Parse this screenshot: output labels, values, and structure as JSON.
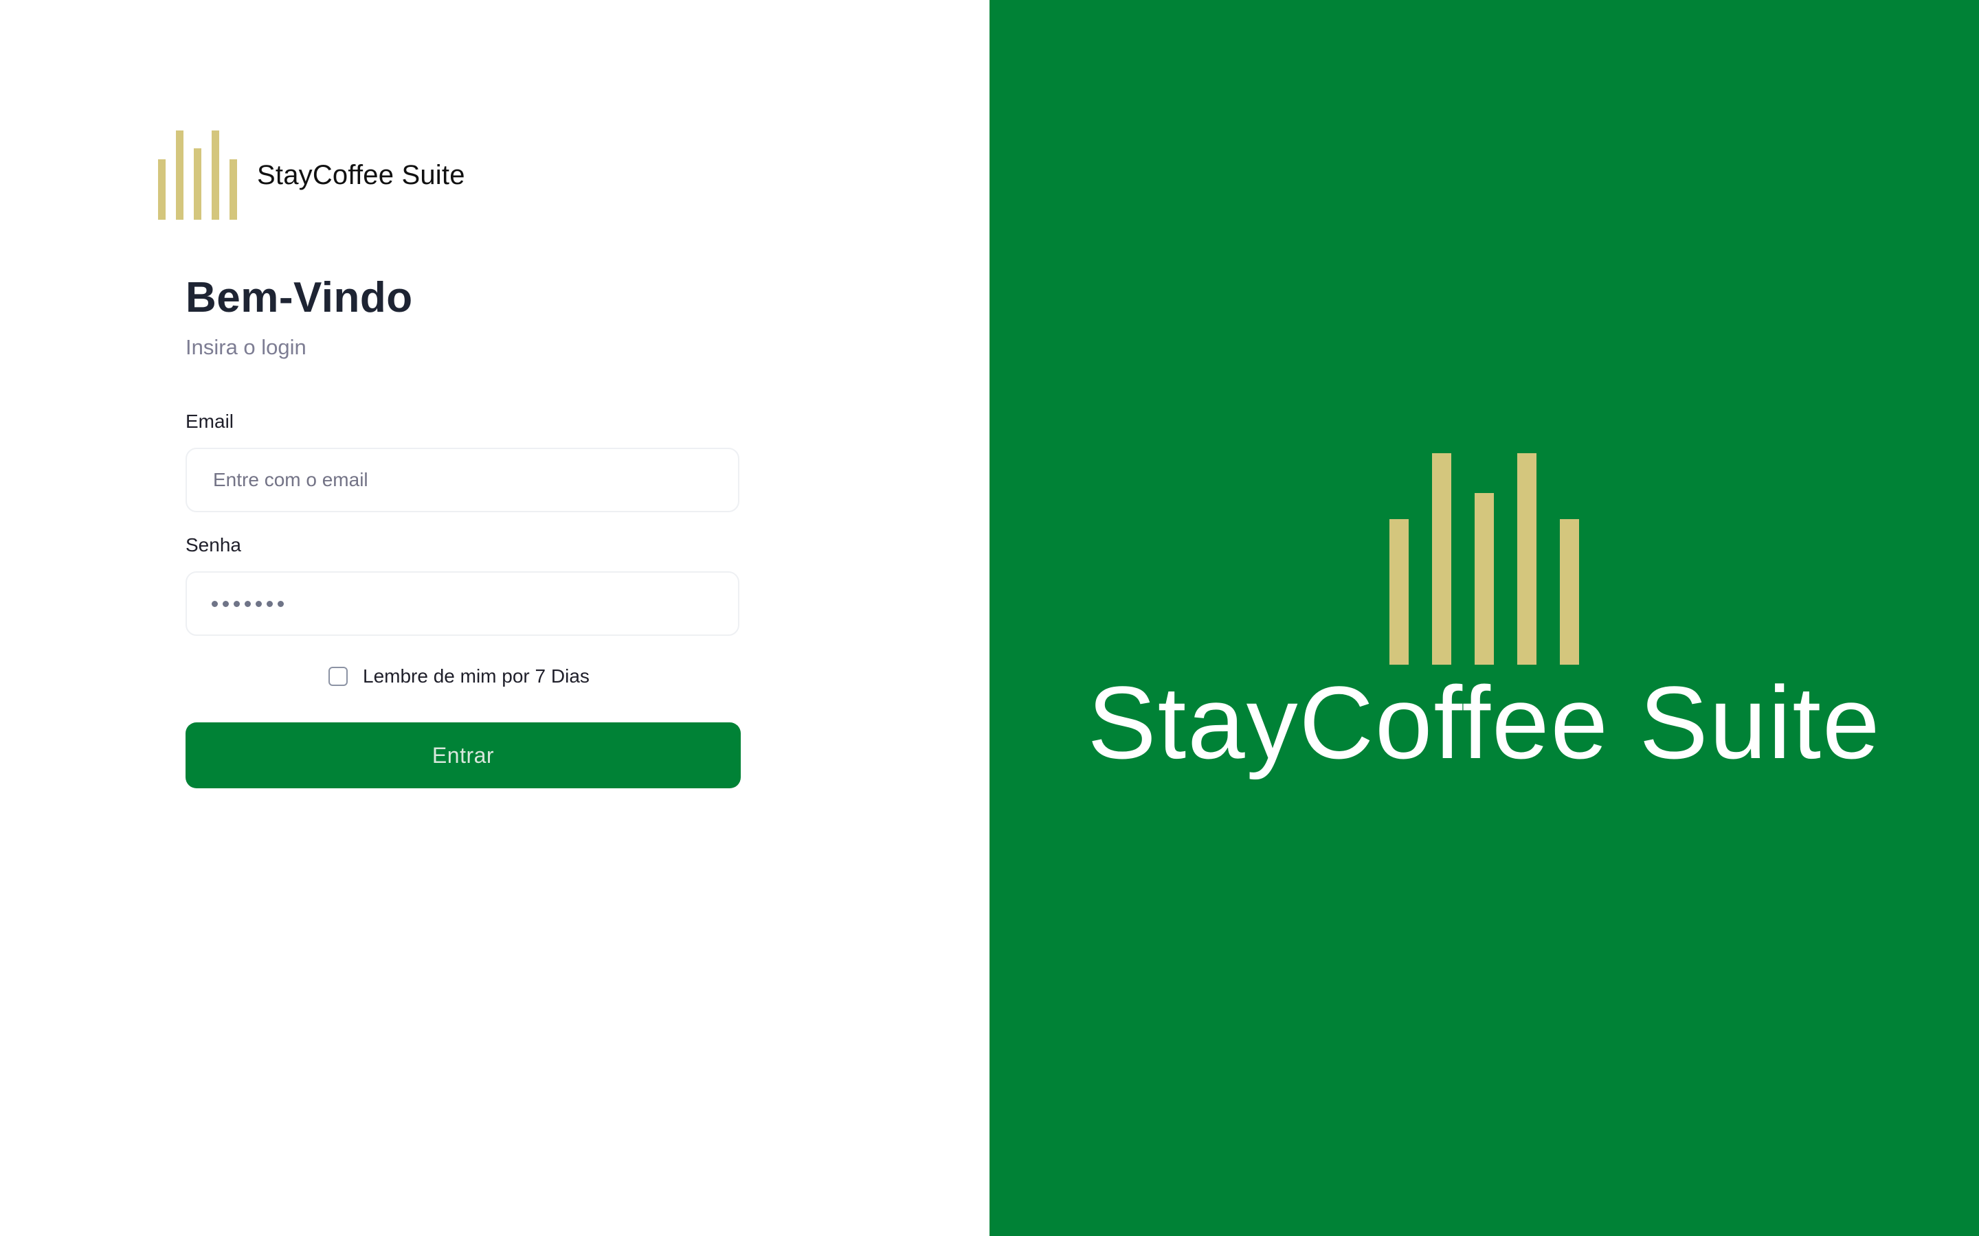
{
  "colors": {
    "brand_green": "#008236",
    "brand_gold": "#d4c67d",
    "heading_text": "#1e2433",
    "muted_text": "#7d7d93"
  },
  "brand": {
    "name": "StayCoffee Suite",
    "logo_icon": "bars-logo-icon"
  },
  "login": {
    "title": "Bem-Vindo",
    "subtitle": "Insira o login",
    "email_label": "Email",
    "email_placeholder": "Entre com o email",
    "email_value": "",
    "password_label": "Senha",
    "password_masked_length": 7,
    "remember_label": "Lembre de mim por 7 Dias",
    "remember_checked": false,
    "submit_label": "Entrar"
  },
  "hero": {
    "name": "StayCoffee Suite",
    "logo_icon": "bars-logo-icon"
  }
}
